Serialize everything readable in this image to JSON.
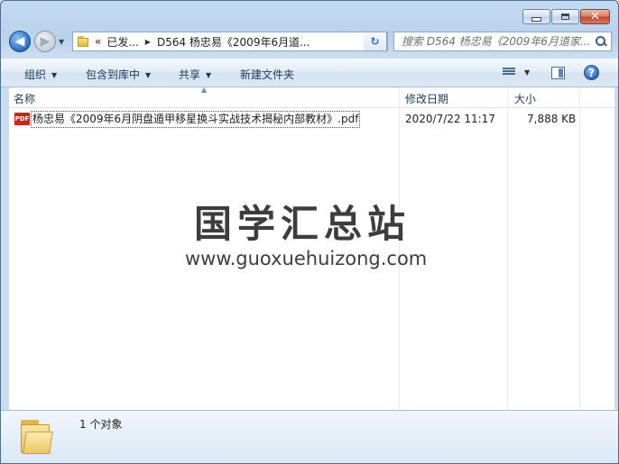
{
  "window": {
    "caption": {
      "minimize": "",
      "maximize": "",
      "close": "✕"
    }
  },
  "nav": {
    "back_arrow": "◀",
    "forward_arrow": "▶",
    "breadcrumb": [
      "«",
      "已发...",
      "D564 杨忠易《2009年6月道..."
    ],
    "refresh_icon": "↻",
    "search_placeholder": "搜索 D564 杨忠易《2009年6月道家..."
  },
  "toolbar": {
    "organize": "组织",
    "include_in_library": "包含到库中",
    "share": "共享",
    "new_folder": "新建文件夹",
    "help": "?"
  },
  "columns": {
    "name": "名称",
    "date_modified": "修改日期",
    "size": "大小"
  },
  "files": [
    {
      "icon": "pdf-icon",
      "icon_text": "PDF",
      "name": "杨忠易《2009年6月阴盘遁甲移星换斗实战技术揭秘内部教材》.pdf",
      "date_modified": "2020/7/22 11:17",
      "size": "7,888 KB"
    }
  ],
  "watermark": {
    "title": "国学汇总站",
    "url": "www.guoxuehuizong.com"
  },
  "details": {
    "item_count": "1 个对象"
  },
  "colors": {
    "accent": "#2a6cc2",
    "pdf_red": "#c6261c",
    "folder_yellow": "#e8bf57"
  }
}
